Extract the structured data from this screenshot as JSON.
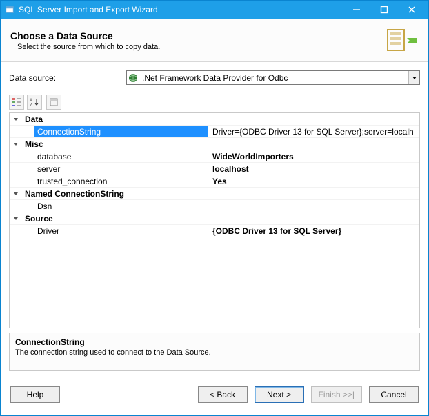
{
  "titlebar": {
    "title": "SQL Server Import and Export Wizard"
  },
  "header": {
    "heading": "Choose a Data Source",
    "subtext": "Select the source from which to copy data."
  },
  "data_source": {
    "label": "Data source:",
    "selected": ".Net Framework Data Provider for Odbc"
  },
  "grid": {
    "categories": [
      {
        "name": "Data",
        "rows": [
          {
            "key": "ConnectionString",
            "value": "Driver={ODBC Driver 13 for SQL Server};server=localh",
            "selected": true,
            "bold": false
          }
        ]
      },
      {
        "name": "Misc",
        "rows": [
          {
            "key": "database",
            "value": "WideWorldImporters",
            "bold": true
          },
          {
            "key": "server",
            "value": "localhost",
            "bold": true
          },
          {
            "key": "trusted_connection",
            "value": "Yes",
            "bold": true
          }
        ]
      },
      {
        "name": "Named ConnectionString",
        "rows": [
          {
            "key": "Dsn",
            "value": ""
          }
        ]
      },
      {
        "name": "Source",
        "rows": [
          {
            "key": "Driver",
            "value": "{ODBC Driver 13 for SQL Server}",
            "bold": true
          }
        ]
      }
    ]
  },
  "description": {
    "title": "ConnectionString",
    "text": "The connection string used to connect to the Data Source."
  },
  "buttons": {
    "help": "Help",
    "back": "< Back",
    "next": "Next >",
    "finish": "Finish >>|",
    "cancel": "Cancel"
  }
}
